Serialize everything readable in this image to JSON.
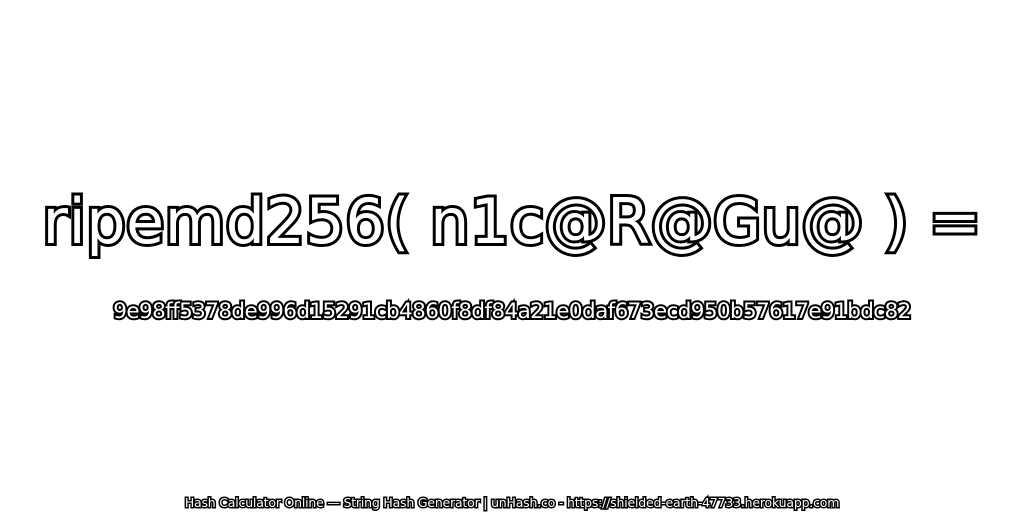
{
  "headline": "ripemd256( n1c@R@Gu@ ) =",
  "hash_value": "9e98ff5378de996d15291cb4860f8df84a21e0daf673ecd950b57617e91bdc82",
  "footer": "Hash Calculator Online — String Hash Generator | unHash.co - https://shielded-earth-47733.herokuapp.com",
  "colors": {
    "background": "#ffffff",
    "text_fill": "#ffffff",
    "text_outline": "#000000"
  }
}
